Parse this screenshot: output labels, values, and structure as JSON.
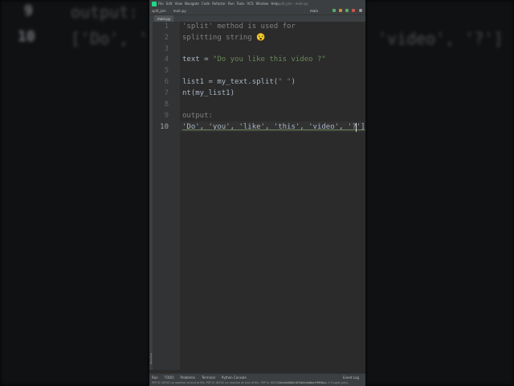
{
  "background": {
    "top_num": "9",
    "top_text": "output:",
    "line_num": "10",
    "left_text": "['Do', '",
    "right_text": "'video', '?']"
  },
  "menu": {
    "items": [
      "File",
      "Edit",
      "View",
      "Navigate",
      "Code",
      "Refactor",
      "Run",
      "Tools",
      "VCS",
      "Window",
      "Help"
    ],
    "window_title": "split_join - main.py"
  },
  "navbar": {
    "project": "split_join",
    "file": "main.py",
    "run_config": "main"
  },
  "tabs": [
    {
      "label": "main.py"
    }
  ],
  "editor": {
    "line_numbers": [
      "1",
      "2",
      "3",
      "4",
      "5",
      "6",
      "7",
      "8",
      "9",
      "10"
    ],
    "lines": {
      "l1": "'split' method is used for",
      "l2": "splitting string 😵",
      "l4a": "text = ",
      "l4b": "\"Do you like this video ?\"",
      "l6a": "list1 = my_text.split(",
      "l6b": "\" \"",
      "l6c": ")",
      "l7": "nt(my_list1)",
      "l9": "output:",
      "l10": "'Do', 'you', 'like', 'this', 'video', '?']"
    }
  },
  "tool_windows": {
    "left_vertical": "Structure",
    "bottom": [
      "Run",
      "TODO",
      "Problems",
      "Terminal",
      "Python Console"
    ],
    "event_log": "Event Log"
  },
  "status": {
    "message": "PEP 8: W292 no newline at end of file, PEP 8: W292 no newline at end of file, PEP 8: W292 no newline at end of file, PEP 8:...",
    "position": "10:44",
    "line_sep": "CRLF",
    "encoding": "UTF-8",
    "indent": "4 spaces",
    "interpreter": "Python 3.9 (split_join)"
  },
  "colors": {
    "editor_bg": "#2b2b2b",
    "comment": "#808080",
    "string": "#6a8759",
    "text": "#a9b7c6",
    "chrome": "#3c3f41"
  }
}
